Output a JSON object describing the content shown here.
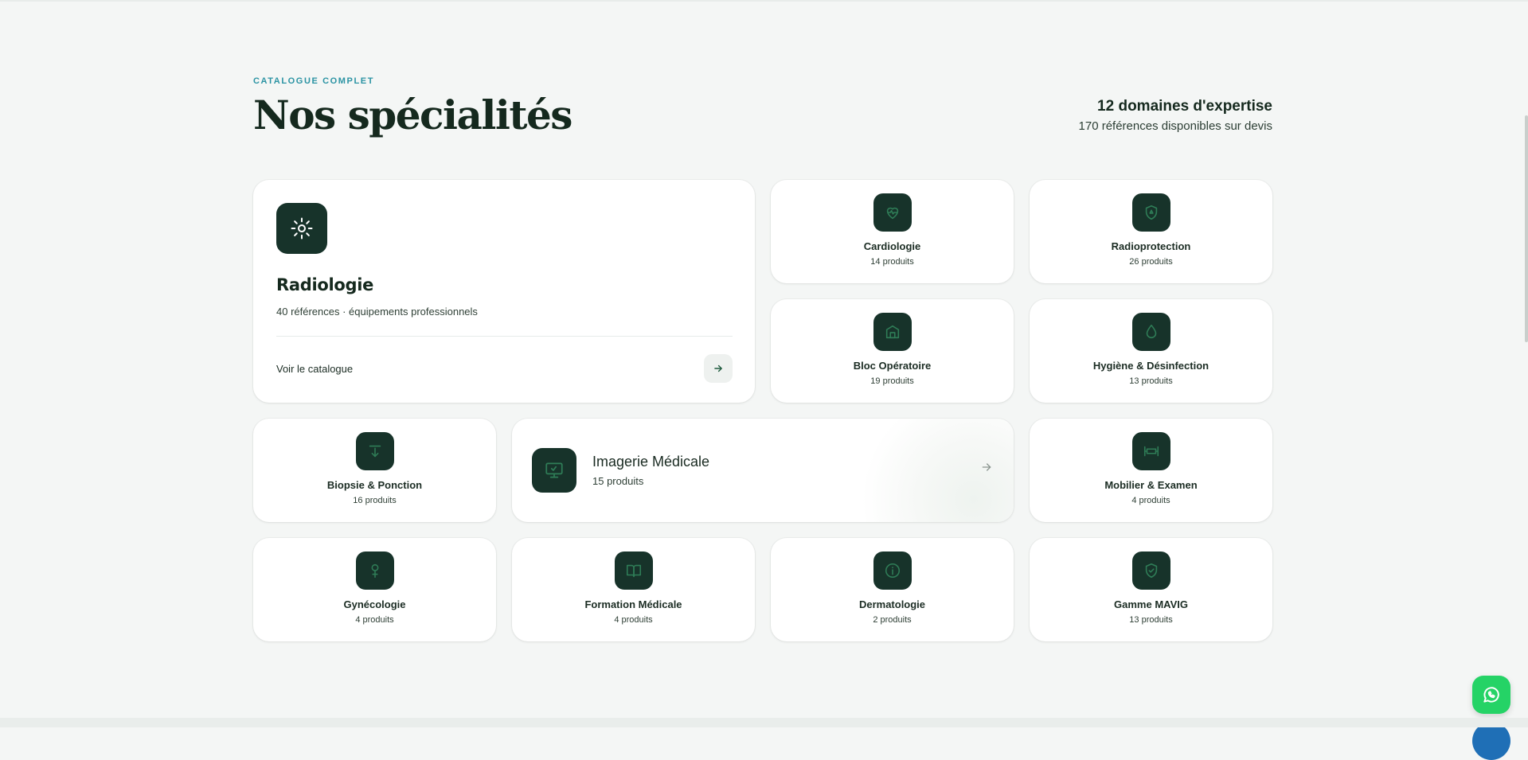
{
  "section": {
    "eyebrow": "CATALOGUE COMPLET",
    "title": "Nos spécialités",
    "stats_primary": "12 domaines d'expertise",
    "stats_secondary": "170 références disponibles sur devis"
  },
  "featured": {
    "name": "Radiologie",
    "description": "40 références · équipements professionnels",
    "link_label": "Voir le catalogue",
    "icon": "sun-icon"
  },
  "wide_card": {
    "name": "Imagerie Médicale",
    "count": "15 produits",
    "icon": "monitor-icon"
  },
  "specialties": [
    {
      "name": "Cardiologie",
      "count": "14 produits",
      "icon": "heart-pulse-icon"
    },
    {
      "name": "Radioprotection",
      "count": "26 produits",
      "icon": "radiation-shield-icon"
    },
    {
      "name": "Bloc Opératoire",
      "count": "19 produits",
      "icon": "building-icon"
    },
    {
      "name": "Hygiène & Désinfection",
      "count": "13 produits",
      "icon": "droplet-icon"
    },
    {
      "name": "Biopsie & Ponction",
      "count": "16 produits",
      "icon": "arrow-down-icon"
    },
    {
      "name": "Mobilier & Examen",
      "count": "4 produits",
      "icon": "bed-icon"
    },
    {
      "name": "Gynécologie",
      "count": "4 produits",
      "icon": "female-icon"
    },
    {
      "name": "Formation Médicale",
      "count": "4 produits",
      "icon": "book-open-icon"
    },
    {
      "name": "Dermatologie",
      "count": "2 produits",
      "icon": "info-circle-icon"
    },
    {
      "name": "Gamme MAVIG",
      "count": "13 produits",
      "icon": "shield-check-icon"
    }
  ],
  "colors": {
    "background": "#f4f6f5",
    "icon_tile": "#17332a",
    "icon_stroke": "#2f7d57",
    "accent_eyebrow": "#2a93a3",
    "whatsapp": "#25d366"
  }
}
